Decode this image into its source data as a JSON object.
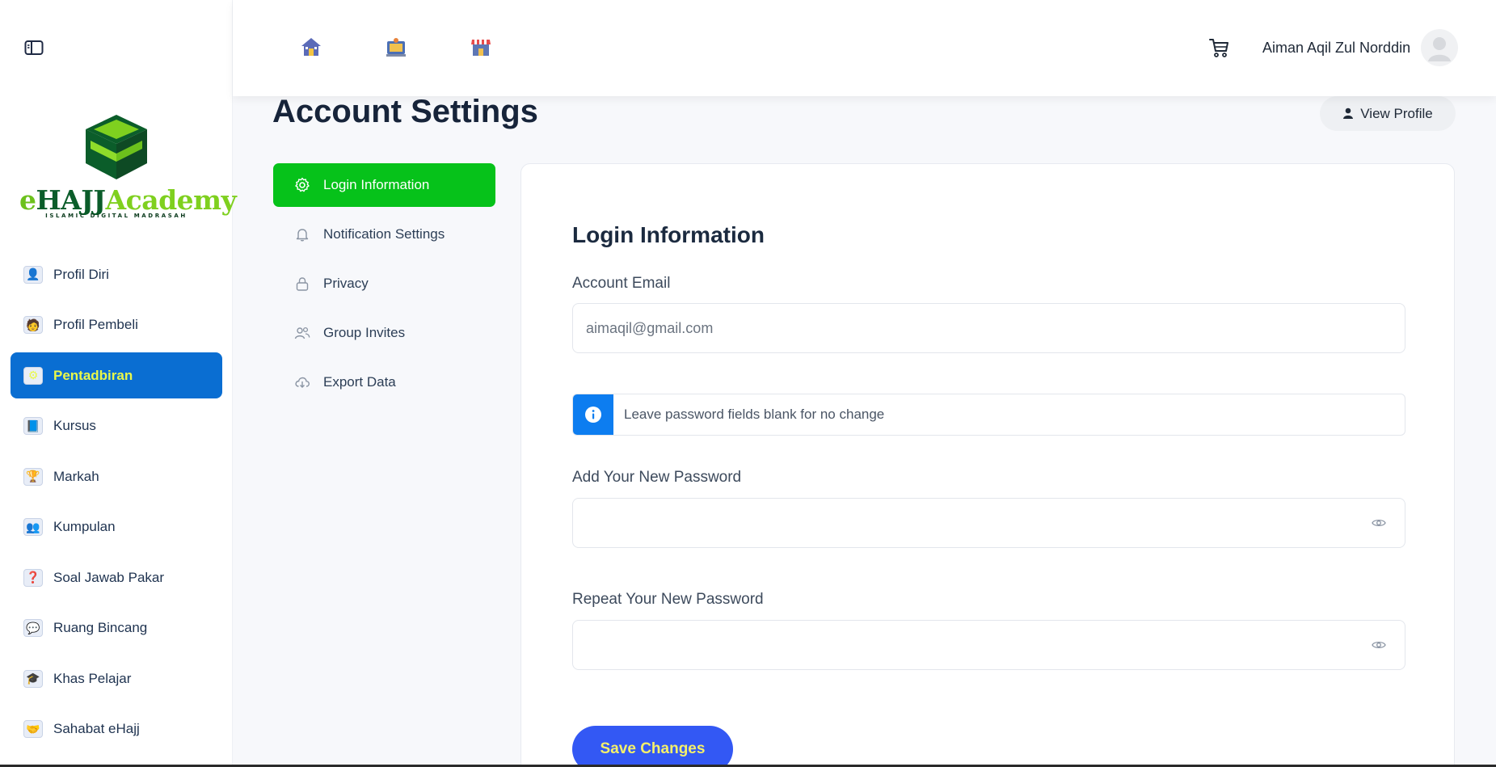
{
  "sidebar": {
    "logo": {
      "e": "e",
      "hajj": "HAJJ",
      "academy": "Academy",
      "tagline": "ISLAMIC DIGITAL MADRASAH"
    },
    "items": [
      {
        "label": "Profil Diri",
        "icon": "person-desk-icon"
      },
      {
        "label": "Profil Pembeli",
        "icon": "buyer-icon"
      },
      {
        "label": "Pentadbiran",
        "icon": "admin-panel-icon",
        "active": true
      },
      {
        "label": "Kursus",
        "icon": "course-icon"
      },
      {
        "label": "Markah",
        "icon": "marks-trophy-icon"
      },
      {
        "label": "Kumpulan",
        "icon": "group-icon"
      },
      {
        "label": "Soal Jawab Pakar",
        "icon": "expert-qa-icon"
      },
      {
        "label": "Ruang Bincang",
        "icon": "discussion-icon"
      },
      {
        "label": "Khas Pelajar",
        "icon": "student-icon"
      },
      {
        "label": "Sahabat eHajj",
        "icon": "friends-icon"
      }
    ]
  },
  "topbar": {
    "icons": [
      "home-icon",
      "classroom-icon",
      "shop-icon"
    ],
    "username": "Aiman Aqil Zul Norddin"
  },
  "page": {
    "title": "Account Settings",
    "view_profile": "View Profile"
  },
  "settings_nav": [
    {
      "label": "Login Information",
      "icon": "gear-icon",
      "active": true
    },
    {
      "label": "Notification Settings",
      "icon": "bell-icon"
    },
    {
      "label": "Privacy",
      "icon": "lock-icon"
    },
    {
      "label": "Group Invites",
      "icon": "users-icon"
    },
    {
      "label": "Export Data",
      "icon": "cloud-download-icon"
    }
  ],
  "form": {
    "title": "Login Information",
    "email_label": "Account Email",
    "email_value": "aimaqil@gmail.com",
    "notice": "Leave password fields blank for no change",
    "new_password_label": "Add Your New Password",
    "repeat_password_label": "Repeat Your New Password",
    "save_label": "Save Changes"
  },
  "colors": {
    "accent_blue": "#0a6ed2",
    "active_green": "#06c21a",
    "save_blue": "#3358f4",
    "highlight_yellow": "#e9f84a"
  }
}
